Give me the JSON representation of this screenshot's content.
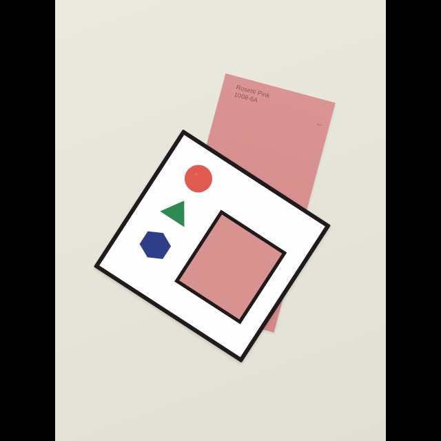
{
  "photo": {
    "background_color": "#e7e6da"
  },
  "swatch_card": {
    "color_name": "Rosetti Pink",
    "color_code": "1008-6A",
    "brand": "behr",
    "color": "#d68e8c"
  },
  "viewer_card": {
    "border_color": "#1f1b1d",
    "shapes": [
      {
        "name": "circle-icon",
        "color": "#e05a4f"
      },
      {
        "name": "triangle-icon",
        "color": "#2e8a52"
      },
      {
        "name": "hexagon-icon",
        "color": "#2e3e88"
      }
    ]
  }
}
